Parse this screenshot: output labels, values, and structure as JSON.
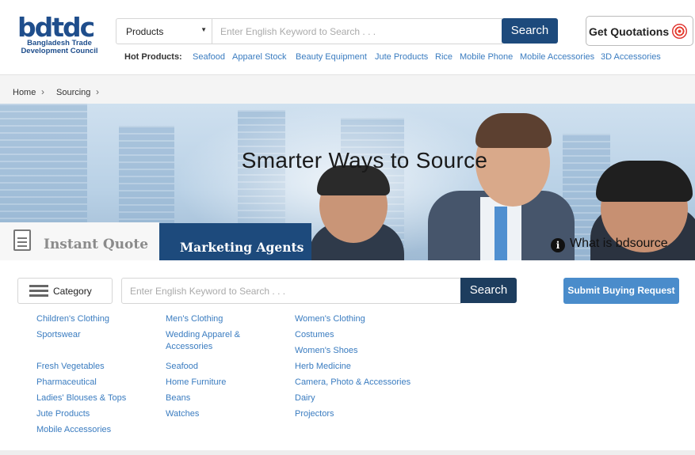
{
  "header": {
    "logo_mark": "bdtdc",
    "logo_line1": "Bangladesh Trade",
    "logo_line2": "Development Council",
    "product_select": "Products",
    "search_placeholder": "Enter English Keyword to Search . . .",
    "search_button": "Search",
    "quote_button": "Get Quotations",
    "hot_label": "Hot Products:",
    "hot_products": [
      "Seafood",
      "Apparel Stock",
      "Beauty Equipment",
      "Jute Products",
      "Rice",
      "Mobile Phone",
      "Mobile Accessories",
      "3D Accessories"
    ]
  },
  "breadcrumb": [
    "Home",
    "Sourcing"
  ],
  "banner": {
    "title": "Smarter Ways to Source",
    "tab_instant": "Instant Quote",
    "tab_agents": "Marketing Agents",
    "what_is": "What is bdsource"
  },
  "sourcing": {
    "category_button": "Category",
    "search_placeholder": "Enter English Keyword to Search . . .",
    "search_button": "Search",
    "submit_button": "Submit Buying Request",
    "columns": [
      [
        "Children's Clothing",
        "Sportswear",
        "Fresh Vegetables",
        "Pharmaceutical",
        "Ladies' Blouses & Tops",
        "Jute Products",
        "Mobile Accessories"
      ],
      [
        "Men's Clothing",
        "Wedding Apparel & Accessories",
        "Seafood",
        "Home Furniture",
        "Beans",
        "Watches"
      ],
      [
        "Women's Clothing",
        "Costumes",
        "Women's Shoes",
        "Herb Medicine",
        "Camera, Photo & Accessories",
        "Dairy",
        "Projectors"
      ]
    ]
  },
  "colors": {
    "brand_navy": "#1d4a7c",
    "link_blue": "#3a7cc0",
    "submit_blue": "#4a8ccb"
  }
}
